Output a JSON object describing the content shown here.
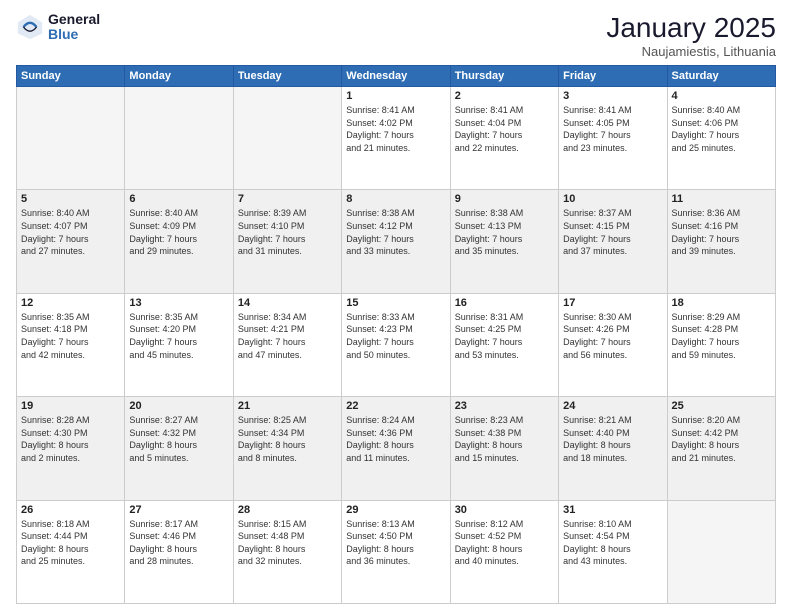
{
  "logo": {
    "general": "General",
    "blue": "Blue"
  },
  "header": {
    "month": "January 2025",
    "location": "Naujamiestis, Lithuania"
  },
  "days_of_week": [
    "Sunday",
    "Monday",
    "Tuesday",
    "Wednesday",
    "Thursday",
    "Friday",
    "Saturday"
  ],
  "weeks": [
    [
      {
        "day": "",
        "info": ""
      },
      {
        "day": "",
        "info": ""
      },
      {
        "day": "",
        "info": ""
      },
      {
        "day": "1",
        "info": "Sunrise: 8:41 AM\nSunset: 4:02 PM\nDaylight: 7 hours\nand 21 minutes."
      },
      {
        "day": "2",
        "info": "Sunrise: 8:41 AM\nSunset: 4:04 PM\nDaylight: 7 hours\nand 22 minutes."
      },
      {
        "day": "3",
        "info": "Sunrise: 8:41 AM\nSunset: 4:05 PM\nDaylight: 7 hours\nand 23 minutes."
      },
      {
        "day": "4",
        "info": "Sunrise: 8:40 AM\nSunset: 4:06 PM\nDaylight: 7 hours\nand 25 minutes."
      }
    ],
    [
      {
        "day": "5",
        "info": "Sunrise: 8:40 AM\nSunset: 4:07 PM\nDaylight: 7 hours\nand 27 minutes."
      },
      {
        "day": "6",
        "info": "Sunrise: 8:40 AM\nSunset: 4:09 PM\nDaylight: 7 hours\nand 29 minutes."
      },
      {
        "day": "7",
        "info": "Sunrise: 8:39 AM\nSunset: 4:10 PM\nDaylight: 7 hours\nand 31 minutes."
      },
      {
        "day": "8",
        "info": "Sunrise: 8:38 AM\nSunset: 4:12 PM\nDaylight: 7 hours\nand 33 minutes."
      },
      {
        "day": "9",
        "info": "Sunrise: 8:38 AM\nSunset: 4:13 PM\nDaylight: 7 hours\nand 35 minutes."
      },
      {
        "day": "10",
        "info": "Sunrise: 8:37 AM\nSunset: 4:15 PM\nDaylight: 7 hours\nand 37 minutes."
      },
      {
        "day": "11",
        "info": "Sunrise: 8:36 AM\nSunset: 4:16 PM\nDaylight: 7 hours\nand 39 minutes."
      }
    ],
    [
      {
        "day": "12",
        "info": "Sunrise: 8:35 AM\nSunset: 4:18 PM\nDaylight: 7 hours\nand 42 minutes."
      },
      {
        "day": "13",
        "info": "Sunrise: 8:35 AM\nSunset: 4:20 PM\nDaylight: 7 hours\nand 45 minutes."
      },
      {
        "day": "14",
        "info": "Sunrise: 8:34 AM\nSunset: 4:21 PM\nDaylight: 7 hours\nand 47 minutes."
      },
      {
        "day": "15",
        "info": "Sunrise: 8:33 AM\nSunset: 4:23 PM\nDaylight: 7 hours\nand 50 minutes."
      },
      {
        "day": "16",
        "info": "Sunrise: 8:31 AM\nSunset: 4:25 PM\nDaylight: 7 hours\nand 53 minutes."
      },
      {
        "day": "17",
        "info": "Sunrise: 8:30 AM\nSunset: 4:26 PM\nDaylight: 7 hours\nand 56 minutes."
      },
      {
        "day": "18",
        "info": "Sunrise: 8:29 AM\nSunset: 4:28 PM\nDaylight: 7 hours\nand 59 minutes."
      }
    ],
    [
      {
        "day": "19",
        "info": "Sunrise: 8:28 AM\nSunset: 4:30 PM\nDaylight: 8 hours\nand 2 minutes."
      },
      {
        "day": "20",
        "info": "Sunrise: 8:27 AM\nSunset: 4:32 PM\nDaylight: 8 hours\nand 5 minutes."
      },
      {
        "day": "21",
        "info": "Sunrise: 8:25 AM\nSunset: 4:34 PM\nDaylight: 8 hours\nand 8 minutes."
      },
      {
        "day": "22",
        "info": "Sunrise: 8:24 AM\nSunset: 4:36 PM\nDaylight: 8 hours\nand 11 minutes."
      },
      {
        "day": "23",
        "info": "Sunrise: 8:23 AM\nSunset: 4:38 PM\nDaylight: 8 hours\nand 15 minutes."
      },
      {
        "day": "24",
        "info": "Sunrise: 8:21 AM\nSunset: 4:40 PM\nDaylight: 8 hours\nand 18 minutes."
      },
      {
        "day": "25",
        "info": "Sunrise: 8:20 AM\nSunset: 4:42 PM\nDaylight: 8 hours\nand 21 minutes."
      }
    ],
    [
      {
        "day": "26",
        "info": "Sunrise: 8:18 AM\nSunset: 4:44 PM\nDaylight: 8 hours\nand 25 minutes."
      },
      {
        "day": "27",
        "info": "Sunrise: 8:17 AM\nSunset: 4:46 PM\nDaylight: 8 hours\nand 28 minutes."
      },
      {
        "day": "28",
        "info": "Sunrise: 8:15 AM\nSunset: 4:48 PM\nDaylight: 8 hours\nand 32 minutes."
      },
      {
        "day": "29",
        "info": "Sunrise: 8:13 AM\nSunset: 4:50 PM\nDaylight: 8 hours\nand 36 minutes."
      },
      {
        "day": "30",
        "info": "Sunrise: 8:12 AM\nSunset: 4:52 PM\nDaylight: 8 hours\nand 40 minutes."
      },
      {
        "day": "31",
        "info": "Sunrise: 8:10 AM\nSunset: 4:54 PM\nDaylight: 8 hours\nand 43 minutes."
      },
      {
        "day": "",
        "info": ""
      }
    ]
  ]
}
